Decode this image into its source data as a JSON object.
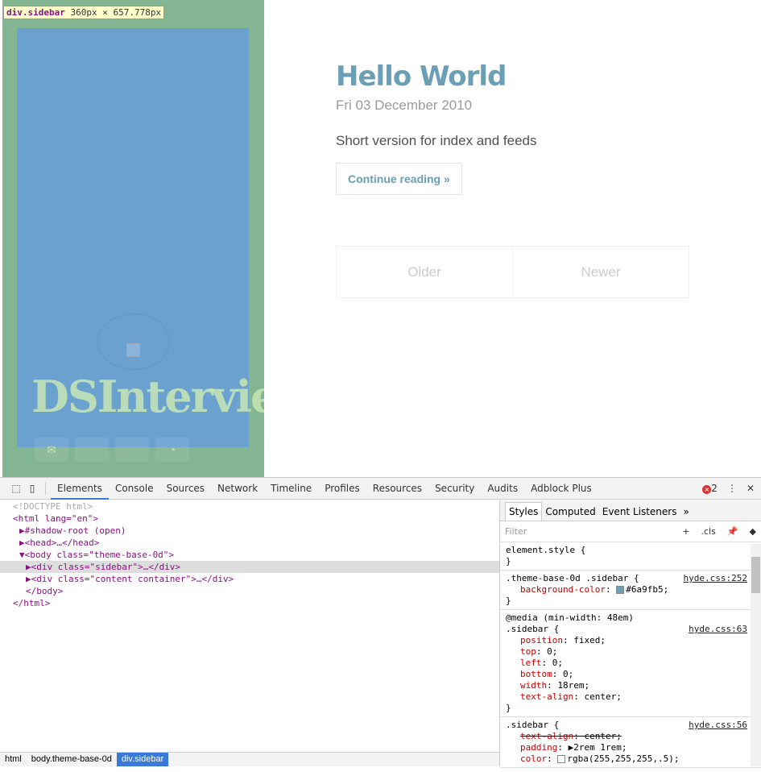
{
  "inspector_tooltip": {
    "selector": "div.sidebar",
    "size": "360px × 657.778px"
  },
  "sidebar": {
    "brand": "DSInterview",
    "social": [
      {
        "icon": "envelope-icon",
        "glyph": "✉"
      },
      {
        "icon": "blank-icon",
        "glyph": ""
      },
      {
        "icon": "blank-icon",
        "glyph": ""
      },
      {
        "icon": "rss-icon",
        "glyph": "◔"
      }
    ],
    "bg_color": "#6a9fb5"
  },
  "post": {
    "title": "Hello World",
    "date": "Fri 03 December 2010",
    "summary": "Short version for index and feeds",
    "continue": "Continue reading »"
  },
  "pager": {
    "older": "Older",
    "newer": "Newer"
  },
  "devtools": {
    "tabs": [
      "Elements",
      "Console",
      "Sources",
      "Network",
      "Timeline",
      "Profiles",
      "Resources",
      "Security",
      "Audits",
      "Adblock Plus"
    ],
    "active_tab": "Elements",
    "error_count": "2",
    "dom": [
      "<!DOCTYPE html>",
      "<html lang=\"en\">",
      "▶#shadow-root (open)",
      "▶<head>…</head>",
      "▼<body class=\"theme-base-0d\">",
      "▶<div class=\"sidebar\">…</div>",
      "▶<div class=\"content container\">…</div>",
      "</body>",
      "</html>"
    ],
    "breadcrumbs": [
      "html",
      "body.theme-base-0d",
      "div.sidebar"
    ],
    "style_tabs": [
      "Styles",
      "Computed",
      "Event Listeners",
      "»"
    ],
    "filter_placeholder": "Filter",
    "filter_tools": [
      "+",
      "◢",
      ".cls",
      "pin-icon",
      "diamond-icon"
    ],
    "rules": [
      {
        "selector": "element.style {",
        "close": "}",
        "source": "",
        "props": []
      },
      {
        "selector": ".theme-base-0d .sidebar {",
        "close": "}",
        "source": "hyde.css:252",
        "props": [
          {
            "name": "background-color",
            "value": "#6a9fb5;",
            "swatch": "#6a9fb5"
          }
        ]
      },
      {
        "media": "@media (min-width: 48em)",
        "selector": ".sidebar {",
        "close": "}",
        "source": "hyde.css:63",
        "props": [
          {
            "name": "position",
            "value": "fixed;"
          },
          {
            "name": "top",
            "value": "0;"
          },
          {
            "name": "left",
            "value": "0;"
          },
          {
            "name": "bottom",
            "value": "0;"
          },
          {
            "name": "width",
            "value": "18rem;"
          },
          {
            "name": "text-align",
            "value": "center;"
          }
        ]
      },
      {
        "selector": ".sidebar {",
        "close": "",
        "source": "hyde.css:56",
        "props": [
          {
            "name": "text-align",
            "value": "center;",
            "struck": true
          },
          {
            "name": "padding",
            "value": "▶2rem 1rem;"
          },
          {
            "name": "color",
            "value": "rgba(255,255,255,.5);",
            "swatch": "rgba(255,255,255,.5)"
          }
        ]
      }
    ]
  }
}
